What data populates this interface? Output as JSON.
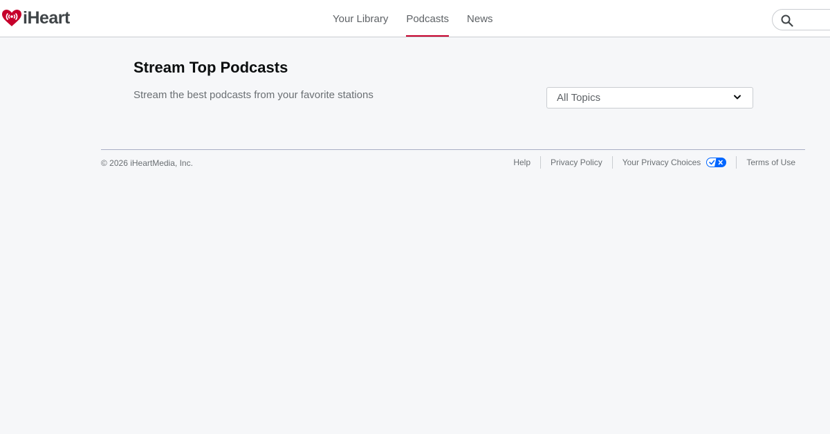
{
  "header": {
    "logo_text": "iHeart",
    "nav": [
      {
        "label": "Your Library",
        "active": false
      },
      {
        "label": "Podcasts",
        "active": true
      },
      {
        "label": "News",
        "active": false
      }
    ],
    "search": {
      "icon": "search-icon"
    }
  },
  "main": {
    "title": "Stream Top Podcasts",
    "subtitle": "Stream the best podcasts from your favorite stations",
    "topic_select": {
      "value": "All Topics",
      "icon": "chevron-down-icon"
    }
  },
  "footer": {
    "copyright": "© 2026 iHeartMedia, Inc.",
    "links": {
      "help": "Help",
      "privacy_policy": "Privacy Policy",
      "privacy_choices": "Your Privacy Choices",
      "terms": "Terms of Use"
    }
  },
  "colors": {
    "brand": "#c6002b",
    "background": "#f6f7f9",
    "privacy_toggle": "#0066ff"
  }
}
